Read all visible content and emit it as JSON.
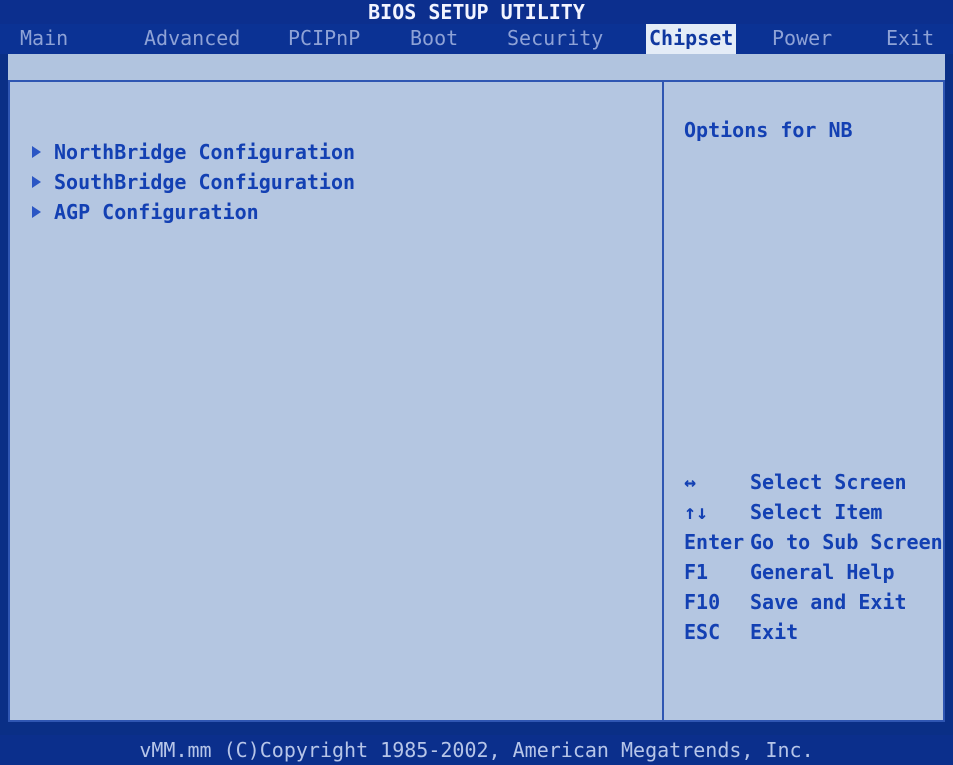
{
  "title": "BIOS SETUP UTILITY",
  "tabs": [
    {
      "label": "Main"
    },
    {
      "label": "Advanced"
    },
    {
      "label": "PCIPnP"
    },
    {
      "label": "Boot"
    },
    {
      "label": "Security"
    },
    {
      "label": "Chipset"
    },
    {
      "label": "Power"
    },
    {
      "label": "Exit"
    }
  ],
  "active_tab": "Chipset",
  "menu": {
    "items": [
      {
        "label": "NorthBridge Configuration",
        "icon": "triangle-right-icon"
      },
      {
        "label": "SouthBridge Configuration",
        "icon": "triangle-right-icon"
      },
      {
        "label": "AGP Configuration",
        "icon": "triangle-right-icon"
      }
    ]
  },
  "help": {
    "text": "Options for NB"
  },
  "legend": [
    {
      "key": "↔",
      "desc": "Select Screen"
    },
    {
      "key": "↑↓",
      "desc": "Select Item"
    },
    {
      "key": "Enter",
      "desc": "Go to Sub Screen"
    },
    {
      "key": "F1",
      "desc": "General Help"
    },
    {
      "key": "F10",
      "desc": "Save and Exit"
    },
    {
      "key": "ESC",
      "desc": "Exit"
    }
  ],
  "footer": "vMM.mm (C)Copyright 1985-2002, American Megatrends, Inc.",
  "colors": {
    "background": "#0a2f86",
    "panel": "#b4c6e1",
    "text": "#1340b3",
    "active_tab_bg": "#e4ecf7",
    "inactive_tab_text": "#8ea2d6"
  }
}
